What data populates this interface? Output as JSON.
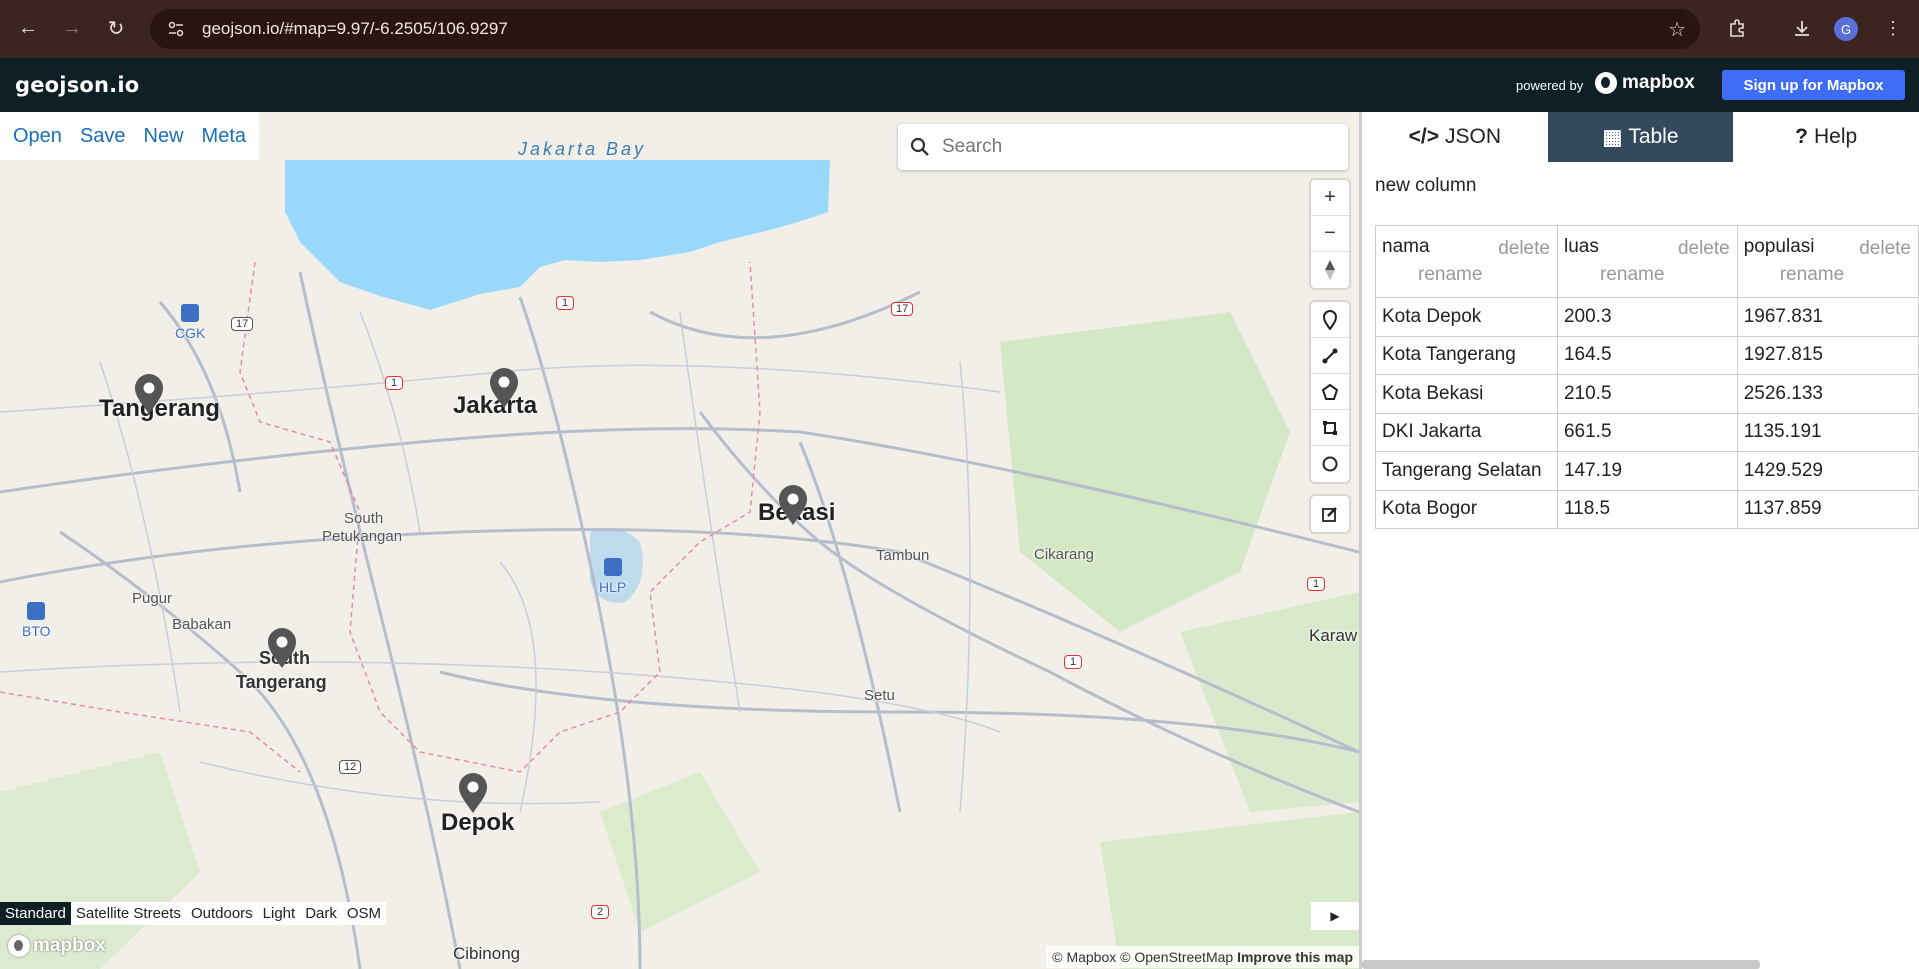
{
  "browser": {
    "url": "geojson.io/#map=9.97/-6.2505/106.9297",
    "profile_initial": "G"
  },
  "header": {
    "logo": "geojson.io",
    "powered_by": "powered by",
    "mapbox": "mapbox",
    "signup": "Sign up for Mapbox"
  },
  "map_menu": [
    "Open",
    "Save",
    "New",
    "Meta"
  ],
  "search": {
    "placeholder": "Search"
  },
  "map_labels": {
    "bay": "Jakarta Bay",
    "jakarta": "Jakarta",
    "tangerang": "Tangerang",
    "bekasi": "Bekasi",
    "south_tangerang_1": "South",
    "south_tangerang_2": "Tangerang",
    "depok": "Depok",
    "south_petukangan_1": "South",
    "south_petukangan_2": "Petukangan",
    "tambun": "Tambun",
    "cikarang": "Cikarang",
    "pugur": "Pugur",
    "babakan": "Babakan",
    "setu": "Setu",
    "cibinong": "Cibinong",
    "karawang": "Karaw",
    "cgk": "CGK",
    "hlp": "HLP",
    "bto": "BTO",
    "shield_1": "1",
    "shield_17": "17",
    "shield_12": "12",
    "shield_2": "2"
  },
  "map_styles": [
    "Standard",
    "Satellite Streets",
    "Outdoors",
    "Light",
    "Dark",
    "OSM"
  ],
  "attribution": {
    "mapbox": "© Mapbox",
    "osm": "© OpenStreetMap",
    "improve": "Improve this map"
  },
  "panel": {
    "tabs": [
      {
        "icon": "</>",
        "label": "JSON"
      },
      {
        "icon": "▦",
        "label": "Table"
      },
      {
        "icon": "?",
        "label": "Help"
      }
    ],
    "new_column": "new column",
    "columns": [
      {
        "name": "nama",
        "delete": "delete",
        "rename": "rename"
      },
      {
        "name": "luas",
        "delete": "delete",
        "rename": "rename"
      },
      {
        "name": "populasi",
        "delete": "delete",
        "rename": "rename"
      }
    ],
    "rows": [
      [
        "Kota Depok",
        "200.3",
        "1967.831"
      ],
      [
        "Kota Tangerang",
        "164.5",
        "1927.815"
      ],
      [
        "Kota Bekasi",
        "210.5",
        "2526.133"
      ],
      [
        "DKI Jakarta",
        "661.5",
        "1135.191"
      ],
      [
        "Tangerang Selatan",
        "147.19",
        "1429.529"
      ],
      [
        "Kota Bogor",
        "118.5",
        "1137.859"
      ]
    ]
  }
}
